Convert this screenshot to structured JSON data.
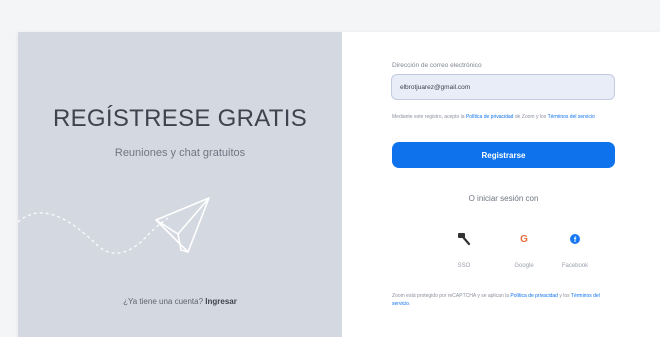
{
  "left_panel": {
    "title": "REGÍSTRESE GRATIS",
    "subtitle": "Reuniones y chat gratuitos",
    "have_account_prefix": "¿Ya tiene una cuenta?",
    "login_link": "Ingresar"
  },
  "signup": {
    "email_label": "Dirección de correo electrónico",
    "email_value": "elbrotjuarez@gmail.com",
    "legal_prefix": "Mediante este registro, acepto la",
    "privacy_link": "Política de privacidad",
    "legal_mid": "de Zoom y los",
    "terms_link": "Términos del servicio",
    "register_button": "Registrarse",
    "or_text": "O iniciar sesión con"
  },
  "social": [
    {
      "label": "SSO",
      "icon": "key-icon"
    },
    {
      "label": "Google",
      "icon": "google-icon"
    },
    {
      "label": "Facebook",
      "icon": "facebook-icon"
    }
  ],
  "footer": {
    "text_prefix": "Zoom está protegido por reCAPTCHA y se aplican la",
    "privacy_link": "Política de privacidad",
    "text_mid": "y los",
    "terms_link": "Términos del servicio",
    "text_suffix": "."
  },
  "colors": {
    "accent": "#0e72ed",
    "left_panel_bg": "#d4d8e0",
    "input_bg": "#e8edf8"
  }
}
